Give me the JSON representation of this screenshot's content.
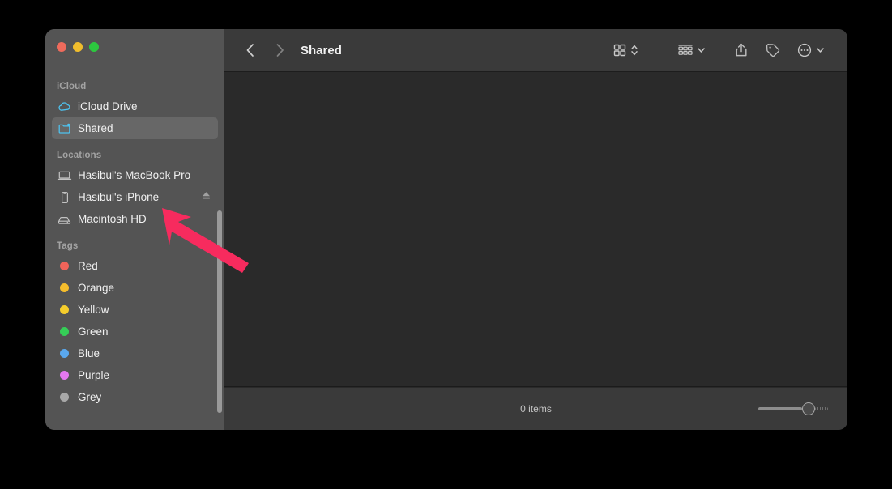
{
  "window": {
    "title": "Shared",
    "traffic_lights": [
      {
        "name": "close",
        "color": "#ef6b5c"
      },
      {
        "name": "minimize",
        "color": "#f0bd2d"
      },
      {
        "name": "zoom",
        "color": "#2dc73f"
      }
    ]
  },
  "toolbar": {
    "back_icon": "chevron-left-icon",
    "forward_icon": "chevron-right-icon",
    "view_mode_icon": "icon-view-icon",
    "view_mode_chevron": "chevron-up-down-icon",
    "group_icon": "group-by-icon",
    "group_chevron": "chevron-down-icon",
    "share_icon": "share-icon",
    "tags_icon": "tag-icon",
    "more_icon": "ellipsis-circle-icon",
    "more_chevron": "chevron-down-icon",
    "search_icon": "search-icon"
  },
  "sidebar": {
    "sections": [
      {
        "header": "iCloud",
        "items": [
          {
            "label": "iCloud Drive",
            "icon": "cloud-icon",
            "selected": false,
            "eject": false
          },
          {
            "label": "Shared",
            "icon": "shared-folder-icon",
            "selected": true,
            "eject": false
          }
        ]
      },
      {
        "header": "Locations",
        "items": [
          {
            "label": "Hasibul's MacBook Pro",
            "icon": "laptop-icon",
            "selected": false,
            "eject": false
          },
          {
            "label": "Hasibul's iPhone",
            "icon": "iphone-icon",
            "selected": false,
            "eject": true
          },
          {
            "label": "Macintosh HD",
            "icon": "hard-drive-icon",
            "selected": false,
            "eject": false
          }
        ]
      },
      {
        "header": "Tags",
        "items": [
          {
            "label": "Red",
            "icon": "tag-dot-icon",
            "color": "#f2645a",
            "selected": false,
            "eject": false
          },
          {
            "label": "Orange",
            "icon": "tag-dot-icon",
            "color": "#f5bd2c",
            "selected": false,
            "eject": false
          },
          {
            "label": "Yellow",
            "icon": "tag-dot-icon",
            "color": "#f5cd2c",
            "selected": false,
            "eject": false
          },
          {
            "label": "Green",
            "icon": "tag-dot-icon",
            "color": "#35ce57",
            "selected": false,
            "eject": false
          },
          {
            "label": "Blue",
            "icon": "tag-dot-icon",
            "color": "#5aa8ee",
            "selected": false,
            "eject": false
          },
          {
            "label": "Purple",
            "icon": "tag-dot-icon",
            "color": "#e478ef",
            "selected": false,
            "eject": false
          },
          {
            "label": "Grey",
            "icon": "tag-dot-icon",
            "color": "#a8a8a8",
            "selected": false,
            "eject": false
          }
        ]
      }
    ]
  },
  "status": {
    "item_count": "0 items",
    "zoom_slider_value": 25
  },
  "annotation": {
    "arrow_color": "#f72b5e",
    "points_at": "Hasibul's iPhone"
  }
}
